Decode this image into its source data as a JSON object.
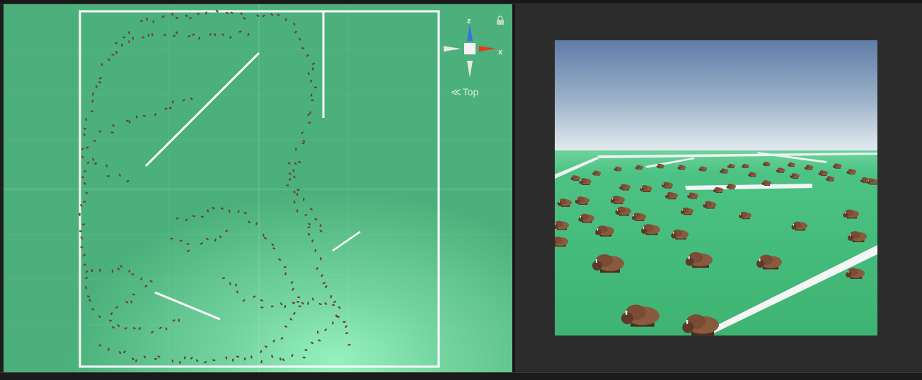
{
  "scene_view": {
    "background": "#4bb07b",
    "gizmo": {
      "axis_z_label": "z",
      "axis_x_label": "x",
      "view_label": "Top",
      "colors": {
        "z": "#3d6fe6",
        "x": "#e03c1f",
        "neutral": "#e8e8e8"
      }
    },
    "lock_icon": "lock-icon",
    "walls_color": "#ffffff",
    "agent_icon": "bison-marker-icon",
    "agent_color": "#6b4437"
  },
  "game_view": {
    "background": "#2c2c2c",
    "sky_top": "#5f7ca8",
    "sky_horizon": "#e7eef2",
    "ground": "#44b978",
    "fence_color": "#f4f6f6",
    "agent_icon": "bison-icon",
    "bison_color": "#8a5a3e"
  }
}
